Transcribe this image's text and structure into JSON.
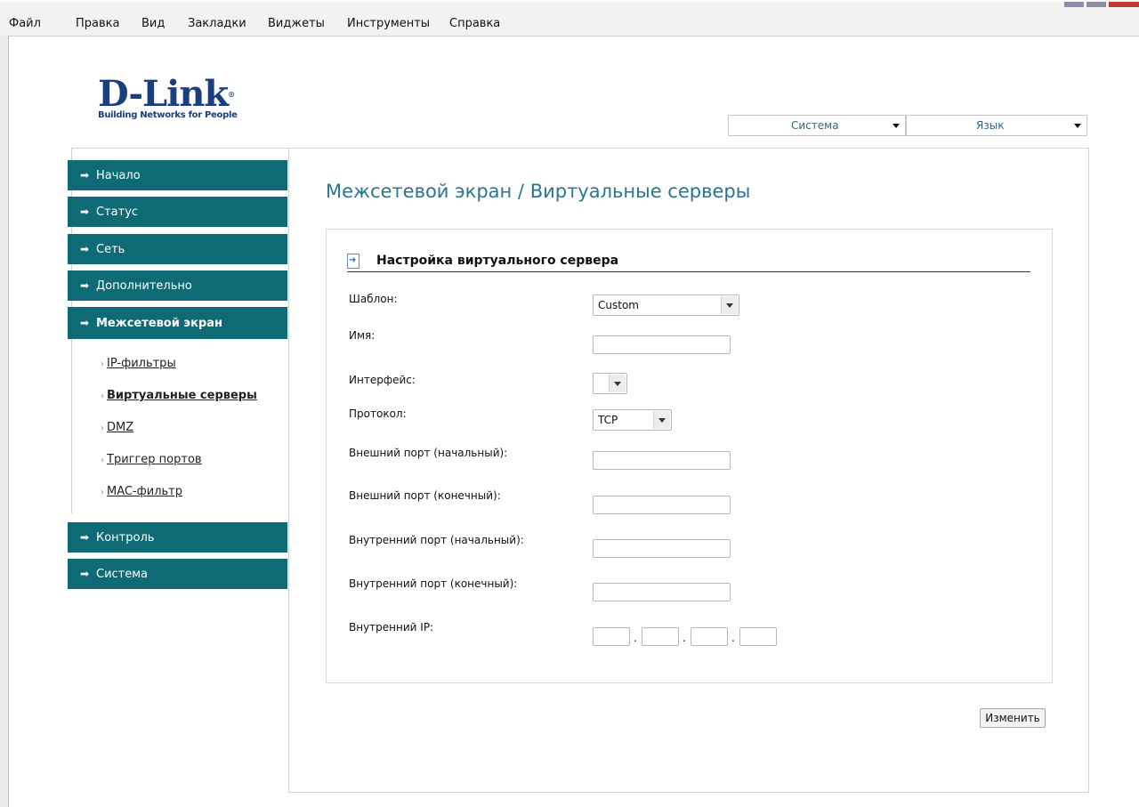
{
  "browser_menu": [
    "Файл",
    "Правка",
    "Вид",
    "Закладки",
    "Виджеты",
    "Инструменты",
    "Справка"
  ],
  "logo": {
    "brand": "D-Link",
    "tagline": "Building Networks for People"
  },
  "top_selects": {
    "system": "Система",
    "language": "Язык"
  },
  "sidebar": {
    "nav": [
      {
        "label": "Начало"
      },
      {
        "label": "Статус"
      },
      {
        "label": "Сеть"
      },
      {
        "label": "Дополнительно"
      },
      {
        "label": "Межсетевой экран",
        "active": true
      },
      {
        "label": "Контроль"
      },
      {
        "label": "Система"
      }
    ],
    "submenu": [
      {
        "label": "IP-фильтры"
      },
      {
        "label": "Виртуальные серверы",
        "active": true
      },
      {
        "label": "DMZ"
      },
      {
        "label": "Триггер портов"
      },
      {
        "label": "MAC-фильтр"
      }
    ]
  },
  "page": {
    "title": "Межсетевой экран / Виртуальные серверы",
    "section_title": "Настройка виртуального сервера",
    "fields": {
      "template_label": "Шаблон:",
      "template_value": "Custom",
      "name_label": "Имя:",
      "name_value": "",
      "interface_label": "Интерфейс:",
      "interface_value": "",
      "protocol_label": "Протокол:",
      "protocol_value": "TCP",
      "ext_port_start_label": "Внешний порт (начальный):",
      "ext_port_end_label": "Внешний порт (конечный):",
      "int_port_start_label": "Внутренний порт (начальный):",
      "int_port_end_label": "Внутренний порт (конечный):",
      "internal_ip_label": "Внутренний IP:"
    },
    "submit_label": "Изменить"
  },
  "colors": {
    "nav_bg": "#0e6b76",
    "title": "#2b7591",
    "brand": "#1b3e7c"
  }
}
